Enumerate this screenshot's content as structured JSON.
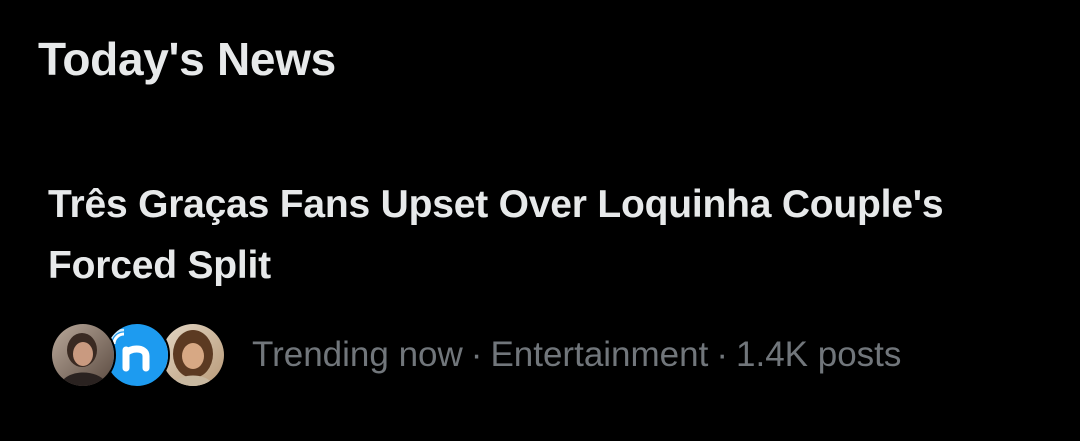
{
  "section": {
    "title": "Today's News"
  },
  "story": {
    "headline": "Três Graças Fans Upset Over Loquinha Couple's Forced Split",
    "status": "Trending now",
    "category": "Entertainment",
    "post_count": "1.4K posts",
    "separator": "·",
    "avatars": [
      {
        "kind": "photo",
        "icon": "person-photo-avatar"
      },
      {
        "kind": "logo",
        "icon": "news-logo-avatar",
        "color": "#1d9bf0"
      },
      {
        "kind": "photo",
        "icon": "person-photo-avatar"
      }
    ]
  },
  "colors": {
    "background": "#000000",
    "primary_text": "#e7e9ea",
    "secondary_text": "#71767b",
    "accent": "#1d9bf0"
  }
}
